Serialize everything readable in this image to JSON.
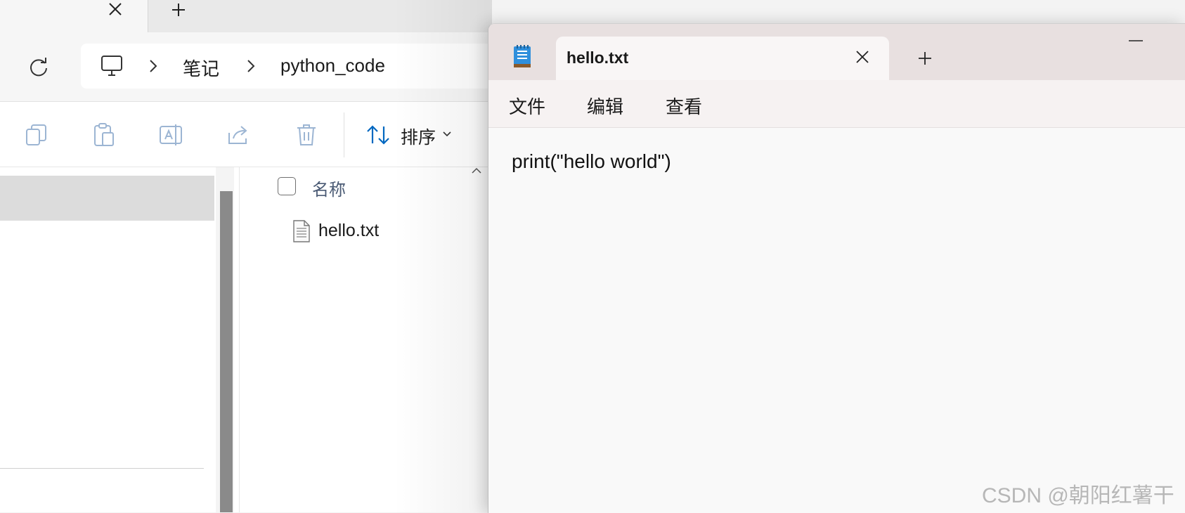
{
  "explorer": {
    "breadcrumb": [
      "笔记",
      "python_code"
    ],
    "toolbar": {
      "sort_label": "排序"
    },
    "columns": {
      "name_header": "名称"
    },
    "files": [
      {
        "name": "hello.txt"
      }
    ]
  },
  "notepad": {
    "tab_title": "hello.txt",
    "menu": [
      "文件",
      "编辑",
      "查看"
    ],
    "content": "print(\"hello world\")"
  },
  "watermark": "CSDN @朝阳红薯干",
  "colors": {
    "accent": "#0067c0",
    "notepad_titlebar": "#e8e0e0"
  }
}
